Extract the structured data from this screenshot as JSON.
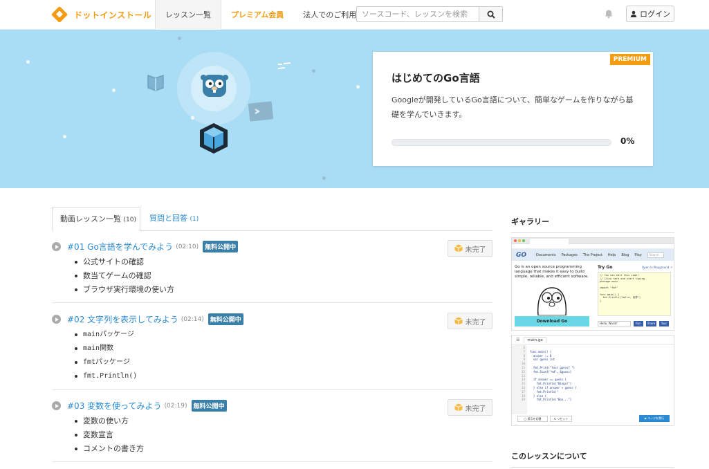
{
  "header": {
    "logo_text": "ドットインストール",
    "nav": [
      "レッスン一覧",
      "プレミアム会員",
      "法人でのご利用"
    ],
    "search_placeholder": "ソースコード、レッスンを検索",
    "login_label": "ログイン"
  },
  "course": {
    "badge": "PREMIUM",
    "title": "はじめてのGo言語",
    "description": "Googleが開発しているGo言語について、簡単なゲームを作りながら基礎を学んでいきます。",
    "progress": 0,
    "progress_label": "0%"
  },
  "tabs": [
    {
      "label": "動画レッスン一覧",
      "count": "(10)"
    },
    {
      "label": "質問と回答",
      "count": "(1)"
    }
  ],
  "lessons": [
    {
      "title": "#01 Go言語を学んでみよう",
      "duration": "(02:10)",
      "badge": "無料公開中",
      "status": "未完了",
      "topics": [
        "公式サイトの確認",
        "数当てゲームの確認",
        "ブラウザ実行環境の使い方"
      ]
    },
    {
      "title": "#02 文字列を表示してみよう",
      "duration": "(02:14)",
      "badge": "無料公開中",
      "status": "未完了",
      "topics": [
        "mainパッケージ",
        "main関数",
        "fmtパッケージ",
        "fmt.Println()"
      ]
    },
    {
      "title": "#03 変数を使ってみよう",
      "duration": "(02:19)",
      "badge": "無料公開中",
      "status": "未完了",
      "topics": [
        "変数の使い方",
        "変数宣言",
        "コメントの書き方"
      ]
    }
  ],
  "sidebar": {
    "gallery_title": "ギャラリー",
    "about_title": "このレッスンについて"
  },
  "gallery": {
    "site": {
      "logo": "GO",
      "nav": [
        "Documents",
        "Packages",
        "The Project",
        "Help",
        "Blog",
        "Play"
      ],
      "search_placeholder": "Search",
      "tagline": "Go is an open source programming language that makes it easy to build simple, reliable, and efficient software.",
      "download": "Download Go",
      "try_title": "Try Go",
      "playground_link": "Open in Playground ↗",
      "example_select": "Hello, World!",
      "run_buttons": [
        "Run",
        "Share",
        "Tour"
      ],
      "code": "// You can edit this code!\n// Click here and start typing.\npackage main\n\nimport \"fmt\"\n\nfunc main() {\n  fmt.Println(\"Hello, 世界\")\n}"
    },
    "editor": {
      "file_tab": "main.go",
      "line_numbers": [
        "6",
        "7",
        "8",
        "9",
        "10",
        "11",
        "12",
        "13",
        "14",
        "15",
        "16",
        "17",
        "18",
        "19"
      ],
      "code": "\nfunc main() {\n  answer := 8\n  var guess int\n\n  fmt.Print(\"Your guess? \")\n  fmt.Scanf(\"%d\", &guess)\n\n  if answer == guess {\n    fmt.Println(\"Bingo!\")\n  } else if answer > guess {\n    fmt.Println(\"\n  } else {\n    fmt.Println(\"Boo...\")",
      "buttons": [
        "表示を切替",
        "リセット"
      ],
      "run_label": "コードを実行"
    }
  }
}
